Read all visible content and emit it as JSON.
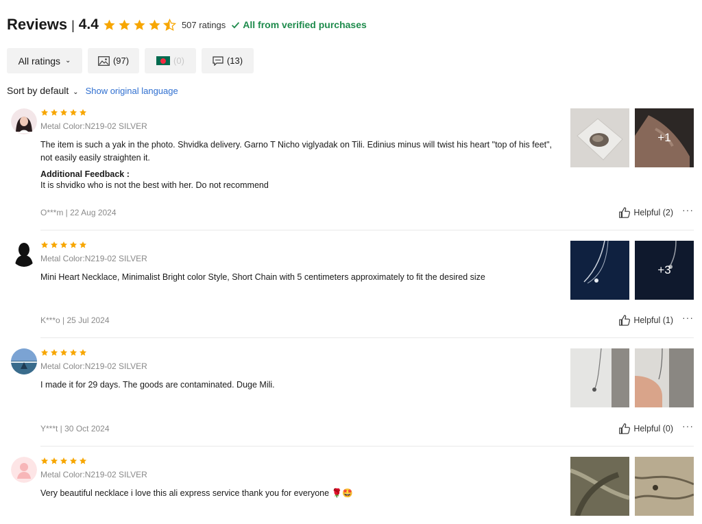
{
  "header": {
    "title": "Reviews",
    "separator": "|",
    "rating": "4.4",
    "rating_value": 4.4,
    "rating_count": "507 ratings",
    "verified": "All from verified purchases"
  },
  "filters": {
    "all_ratings": "All ratings",
    "with_images": "(97)",
    "country": "(0)",
    "with_comments": "(13)"
  },
  "sort": {
    "label": "Sort by default",
    "show_original": "Show original language"
  },
  "colors": {
    "star": "#f7a600",
    "verified": "#1e8b4c",
    "link": "#2f6fd0"
  },
  "reviews": [
    {
      "stars": 5,
      "sku": "Metal Color:N219-02 SILVER",
      "text": "The item is such a yak in the photo. Shvidka delivery. Garno T Nicho viglyadak on Tili. Edinius minus will twist his heart \"top of his feet\", not easily easily straighten it.",
      "additional_title": "Additional Feedback :",
      "additional_text": "It is shvidko who is not the best with her. Do not recommend",
      "author_date": "O***m | 22 Aug 2024",
      "helpful": "Helpful (2)",
      "more_photos": "+1"
    },
    {
      "stars": 5,
      "sku": "Metal Color:N219-02 SILVER",
      "text": "Mini Heart Necklace, Minimalist Bright color Style, Short Chain with 5 centimeters approximately to fit the desired size",
      "author_date": "K***o | 25 Jul 2024",
      "helpful": "Helpful (1)",
      "more_photos": "+3"
    },
    {
      "stars": 5,
      "sku": "Metal Color:N219-02 SILVER",
      "text": "I made it for 29 days. The goods are contaminated. Duge Mili.",
      "author_date": "Y***t | 30 Oct 2024",
      "helpful": "Helpful (0)"
    },
    {
      "stars": 5,
      "sku": "Metal Color:N219-02 SILVER",
      "text": "Very beautiful necklace i love this ali express service thank you for everyone 🌹🤩"
    }
  ],
  "more_label": "···"
}
